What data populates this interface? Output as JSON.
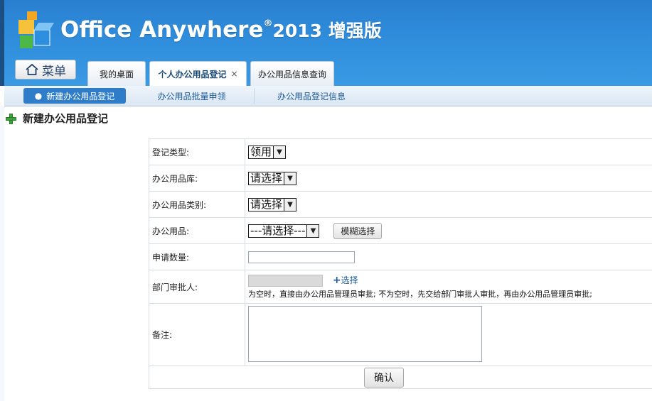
{
  "app": {
    "title_main": "Office Anywhere",
    "title_reg": "®",
    "title_version": "2013 增强版"
  },
  "header": {
    "menu_label": "菜单",
    "tabs": [
      {
        "label": "我的桌面"
      },
      {
        "label": "个人办公用品登记",
        "close": "×"
      },
      {
        "label": "办公用品信息查询"
      }
    ]
  },
  "subnav": {
    "items": [
      {
        "label": "新建办公用品登记"
      },
      {
        "label": "办公用品批量申领"
      },
      {
        "label": "办公用品登记信息"
      }
    ]
  },
  "page": {
    "heading": "新建办公用品登记"
  },
  "form": {
    "type_label": "登记类型:",
    "type_value": "领用",
    "depot_label": "办公用品库:",
    "depot_value": "请选择",
    "category_label": "办公用品类别:",
    "category_value": "请选择",
    "item_label": "办公用品:",
    "item_value": "---请选择---",
    "fuzzy_select": "模糊选择",
    "quantity_label": "申请数量:",
    "quantity_value": "",
    "approver_label": "部门审批人:",
    "approver_add": "选择",
    "approver_hint": "为空时，直接由办公用品管理员审批;  不为空时，先交给部门审批人审批，再由办公用品管理员审批;",
    "note_label": "备注:",
    "note_value": "",
    "confirm": "确认"
  }
}
